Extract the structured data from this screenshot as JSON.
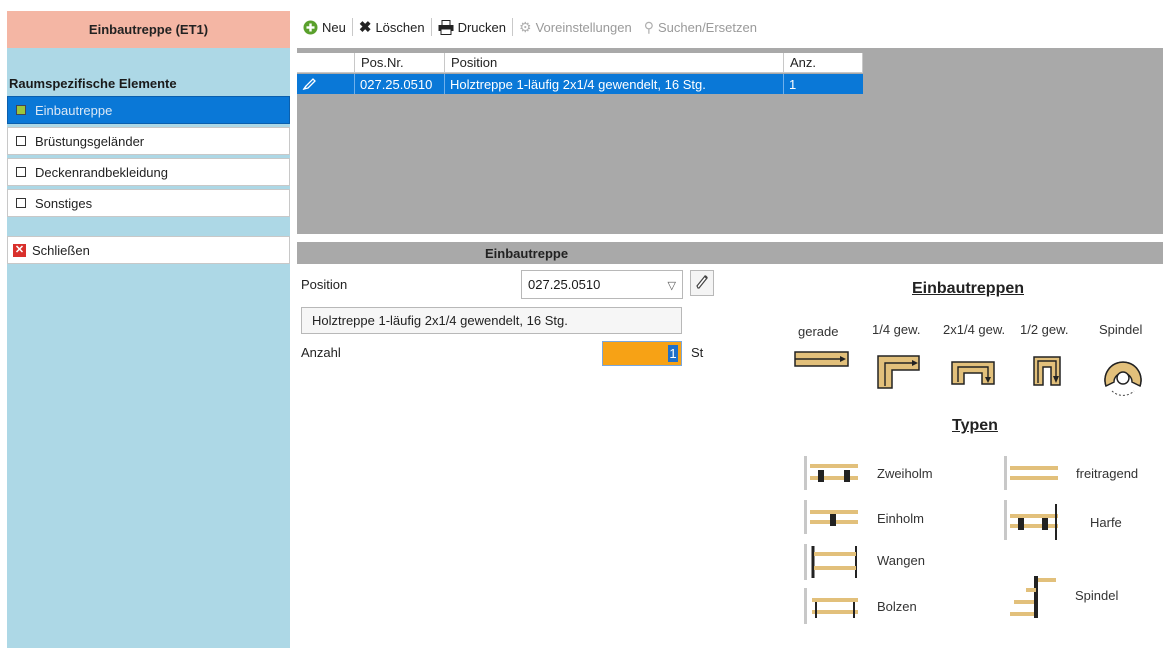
{
  "left": {
    "title": "Einbautreppe (ET1)",
    "section": "Raumspezifische Elemente",
    "items": [
      {
        "label": "Einbautreppe",
        "selected": true
      },
      {
        "label": "Brüstungsgeländer",
        "selected": false
      },
      {
        "label": "Deckenrandbekleidung",
        "selected": false
      },
      {
        "label": "Sonstiges",
        "selected": false
      }
    ],
    "close_label": "Schließen"
  },
  "toolbar": {
    "new_label": "Neu",
    "delete_label": "Löschen",
    "print_label": "Drucken",
    "presets_label": "Voreinstellungen",
    "search_replace_label": "Suchen/Ersetzen"
  },
  "grid": {
    "columns": [
      "Pos.Nr.",
      "Position",
      "Anz."
    ],
    "rows": [
      {
        "pos_nr": "027.25.0510",
        "position": "Holztreppe 1-läufig 2x1/4 gewendelt, 16 Stg.",
        "anz": "1"
      }
    ]
  },
  "detail": {
    "header": "Einbautreppe",
    "position_label": "Position",
    "position_value": "027.25.0510",
    "description": "Holztreppe 1-läufig 2x1/4 gewendelt, 16 Stg.",
    "anzahl_label": "Anzahl",
    "anzahl_value": "1",
    "unit": "St"
  },
  "diagram": {
    "title": "Einbautreppen",
    "stair_types": [
      "gerade",
      "1/4 gew.",
      "2x1/4 gew.",
      "1/2 gew.",
      "Spindel"
    ],
    "types_title": "Typen",
    "types": {
      "zweiholm": "Zweiholm",
      "freitragend": "freitragend",
      "einholm": "Einholm",
      "harfe": "Harfe",
      "wangen": "Wangen",
      "bolzen": "Bolzen",
      "spindel": "Spindel"
    }
  },
  "colors": {
    "accent": "#0a78d7",
    "left_panel": "#add8e6",
    "title_bar": "#f4b6a4",
    "qty_field": "#f7a215",
    "stair_wood": "#e2c07b"
  }
}
